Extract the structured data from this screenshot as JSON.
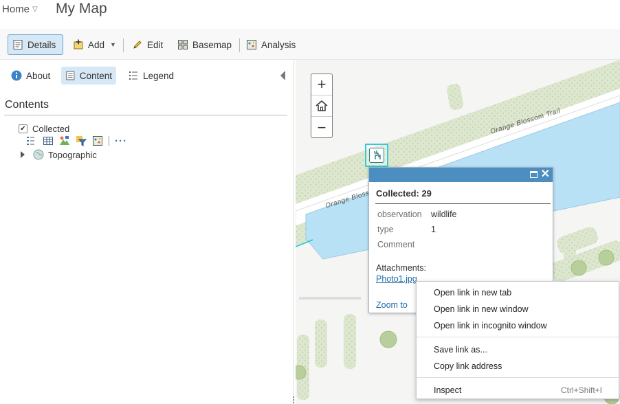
{
  "header": {
    "home_label": "Home",
    "map_title": "My Map"
  },
  "toolbar": {
    "details": "Details",
    "add": "Add",
    "edit": "Edit",
    "basemap": "Basemap",
    "analysis": "Analysis"
  },
  "panel": {
    "tabs": {
      "about": "About",
      "content": "Content",
      "legend": "Legend"
    },
    "heading": "Contents",
    "layers": [
      {
        "name": "Collected",
        "checked": true
      },
      {
        "name": "Topographic"
      }
    ]
  },
  "map": {
    "street_label_1": "Orange Blossom Trail",
    "street_label_2": "Orange Blosso",
    "water_color": "#b9e1f6",
    "park_color": "#dde7cf"
  },
  "popup": {
    "title": "Collected: 29",
    "attributes": [
      {
        "key": "observation",
        "value": "wildlife"
      },
      {
        "key": "type",
        "value": "1"
      },
      {
        "key": "Comment",
        "value": ""
      }
    ],
    "attachments_label": "Attachments:",
    "attachment_file": "Photo1.jpg",
    "zoom_to": "Zoom to"
  },
  "context_menu": {
    "items": [
      {
        "label": "Open link in new tab"
      },
      {
        "label": "Open link in new window"
      },
      {
        "label": "Open link in incognito window"
      },
      {
        "label": "Save link as..."
      },
      {
        "label": "Copy link address"
      },
      {
        "label": "Inspect",
        "shortcut": "Ctrl+Shift+I"
      }
    ]
  }
}
